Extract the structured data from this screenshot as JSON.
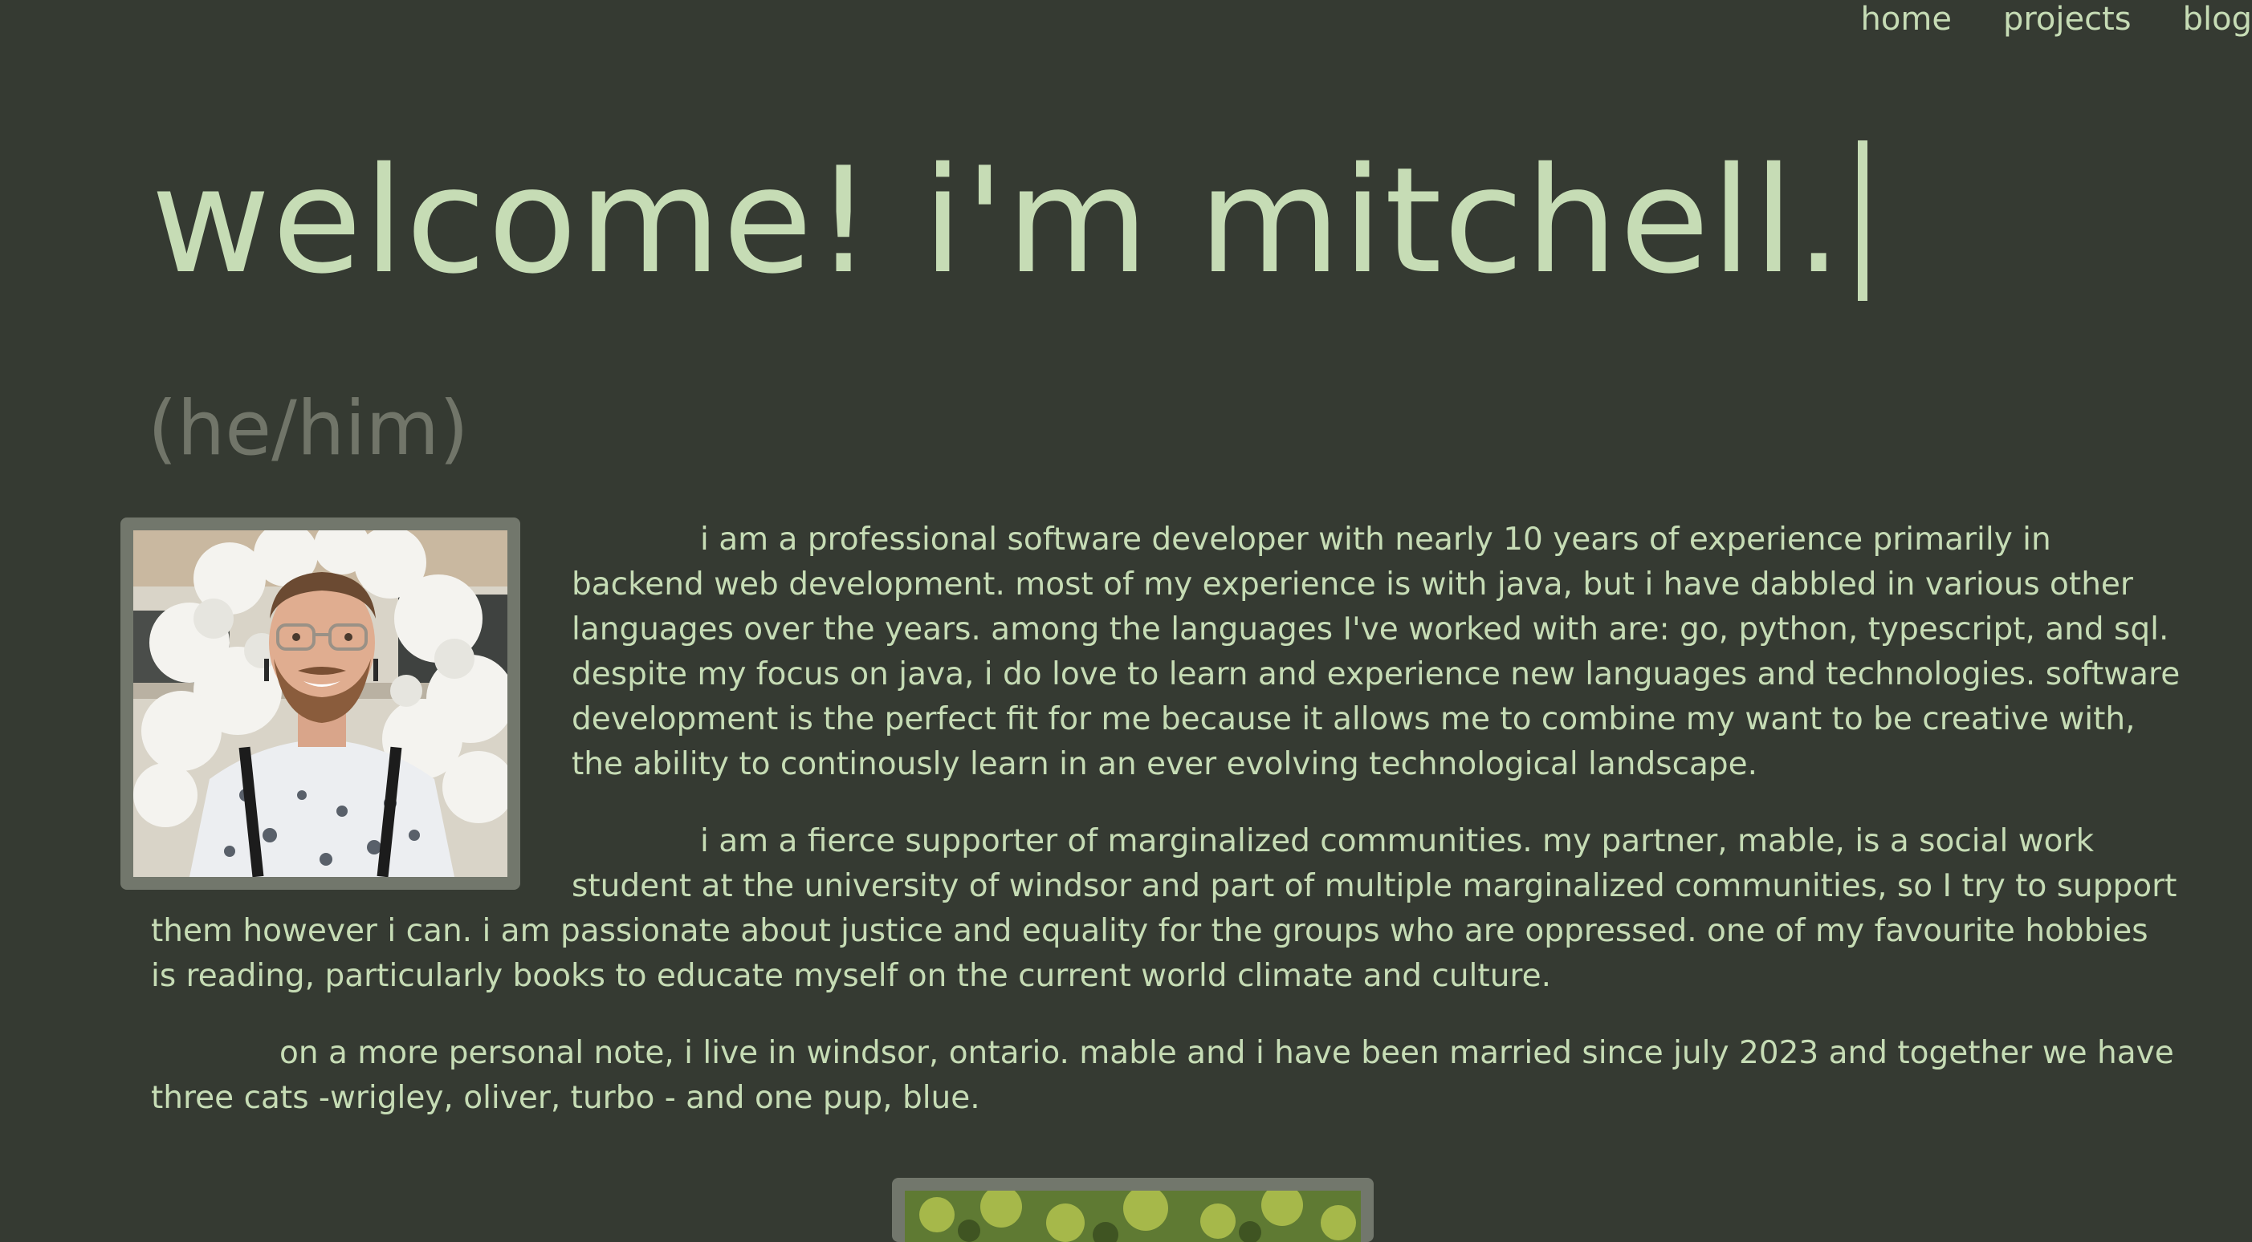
{
  "nav": {
    "items": [
      {
        "label": "home"
      },
      {
        "label": "projects"
      },
      {
        "label": "blog"
      }
    ]
  },
  "hero": {
    "title": "welcome! i'm mitchell.",
    "pronouns": "(he/him)"
  },
  "about": {
    "paragraphs": [
      "i am a professional software developer with nearly 10 years of experience primarily in backend web development. most of my experience is with java, but i have dabbled in various other languages over the years. among the languages I've worked with are: go, python, typescript, and sql. despite my focus on java, i do love to learn and experience new languages and technologies. software development is the perfect fit for me because it allows me to combine my want to be creative with, the ability to continously learn in an ever evolving technological landscape.",
      "i am a fierce supporter of marginalized communities. my partner, mable, is a social work student at the university of windsor and part of multiple marginalized communities, so I try to support them however i can. i am passionate about justice and equality for the groups who are oppressed. one of my favourite hobbies is reading, particularly books to educate myself on the current world climate and culture.",
      "on a more personal note, i live in windsor, ontario. mable and i have been married since july 2023 and together we have three cats -wrigley, oliver, turbo - and one pup, blue."
    ]
  },
  "colors": {
    "background": "#353a32",
    "text": "#c6dcb5",
    "muted": "#717569",
    "frame": "#72776c"
  }
}
